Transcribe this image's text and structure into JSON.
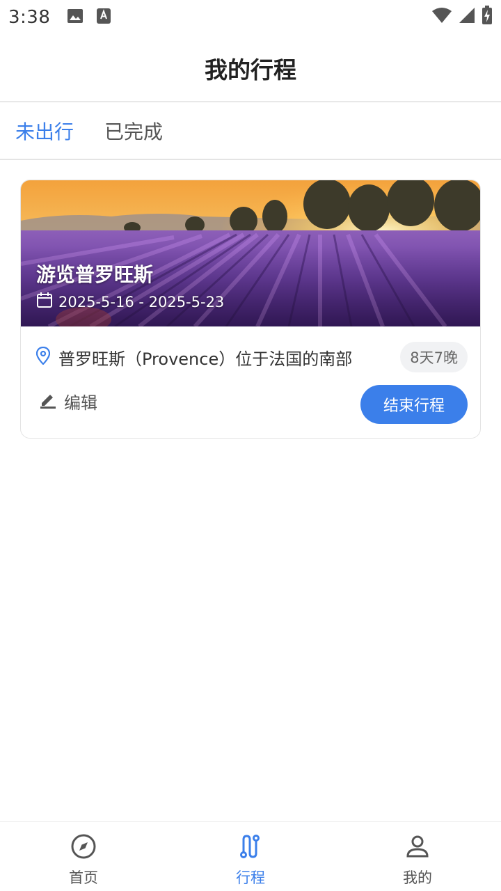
{
  "status_bar": {
    "time": "3:38"
  },
  "header": {
    "title": "我的行程"
  },
  "tabs": [
    {
      "label": "未出行",
      "active": true
    },
    {
      "label": "已完成",
      "active": false
    }
  ],
  "trip": {
    "title": "游览普罗旺斯",
    "dates": "2025-5-16 - 2025-5-23",
    "location": "普罗旺斯（Provence）位于法国的南部",
    "duration": "8天7晚",
    "edit_label": "编辑",
    "end_button_label": "结束行程"
  },
  "bottom_nav": [
    {
      "label": "首页",
      "icon": "compass-icon",
      "active": false
    },
    {
      "label": "行程",
      "icon": "route-icon",
      "active": true
    },
    {
      "label": "我的",
      "icon": "person-icon",
      "active": false
    }
  ],
  "colors": {
    "accent": "#3b7fea",
    "badge_bg": "#f1f2f4"
  }
}
